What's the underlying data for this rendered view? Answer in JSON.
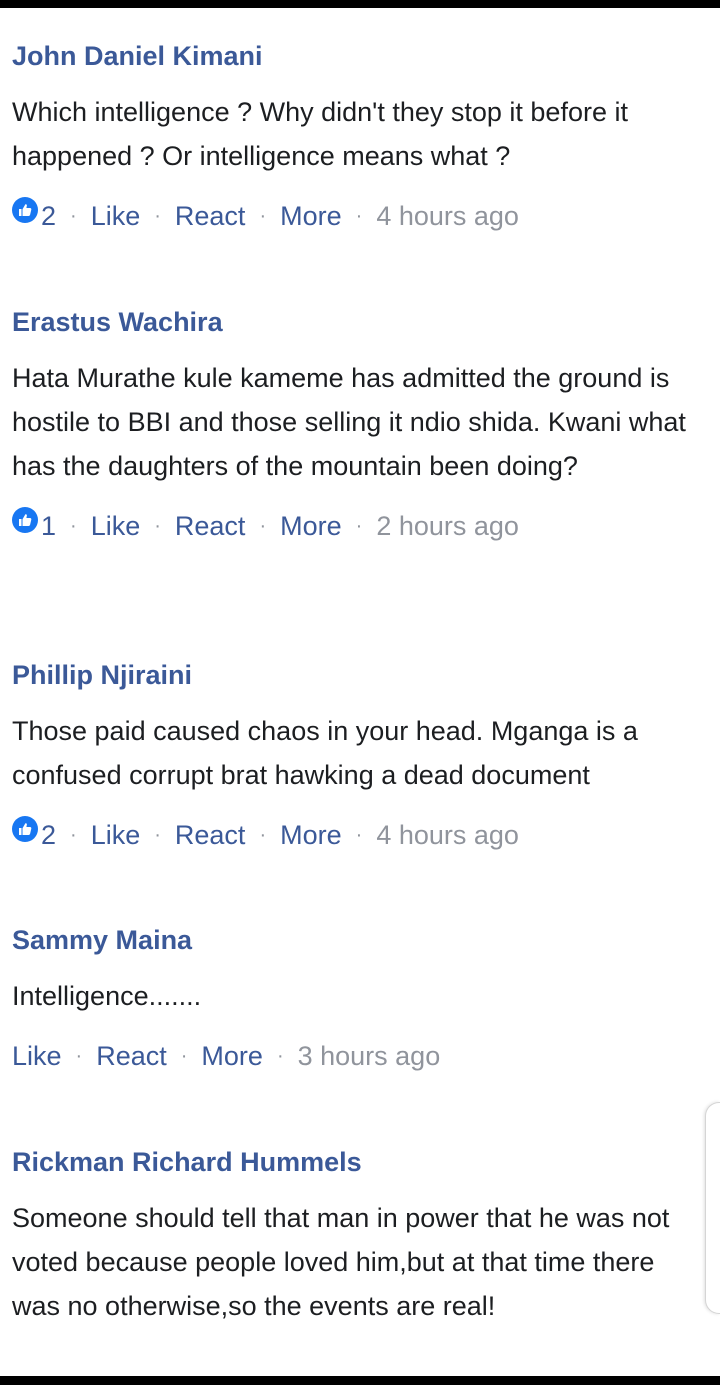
{
  "comments": [
    {
      "author": "John Daniel Kimani",
      "text": "Which intelligence ? Why didn't they stop it before it happened ? Or intelligence means what ?",
      "reaction_count": "2",
      "like_label": "Like",
      "react_label": "React",
      "more_label": "More",
      "time": "4 hours ago"
    },
    {
      "author": "Erastus Wachira",
      "text": "Hata Murathe kule kameme has admitted the ground is hostile to BBI and those selling it ndio shida. Kwani what has the daughters of the mountain been doing?",
      "reaction_count": "1",
      "like_label": "Like",
      "react_label": "React",
      "more_label": "More",
      "time": "2 hours ago"
    },
    {
      "author": "Phillip Njiraini",
      "text": "Those paid caused chaos in your head. Mganga is a confused corrupt brat hawking a dead document",
      "reaction_count": "2",
      "like_label": "Like",
      "react_label": "React",
      "more_label": "More",
      "time": "4 hours ago"
    },
    {
      "author": "Sammy Maina",
      "text": "Intelligence.......",
      "like_label": "Like",
      "react_label": "React",
      "more_label": "More",
      "time": "3 hours ago"
    },
    {
      "author": "Rickman Richard Hummels",
      "text": "Someone should tell that man in power that he was not voted because people loved him,but at that time there was no otherwise,so the events are real!"
    }
  ],
  "separator": "·",
  "icons": {
    "reaction": "like-reaction-icon",
    "scroll": "scroll-handle"
  },
  "colors": {
    "author": "#3b5998",
    "link": "#3b5998",
    "meta": "#90949c",
    "text": "#1c1e21",
    "like_badge": "#1877f2"
  }
}
